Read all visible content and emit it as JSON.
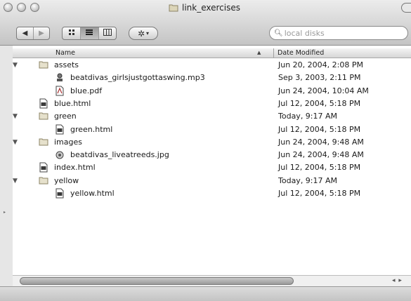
{
  "window": {
    "title": "link_exercises"
  },
  "toolbar": {
    "back_icon": "back-arrow-icon",
    "forward_icon": "forward-arrow-icon",
    "view_icons": [
      "icon-view-icon",
      "list-view-icon",
      "column-view-icon"
    ],
    "action_icon": "gear-icon"
  },
  "search": {
    "placeholder": "local disks"
  },
  "columns": {
    "name": "Name",
    "date": "Date Modified"
  },
  "rows": [
    {
      "name": "assets",
      "date": "Jun 20, 2004, 2:08 PM",
      "icon": "folder-icon",
      "level": 0,
      "expanded": true
    },
    {
      "name": "beatdivas_girlsjustgottaswing.mp3",
      "date": "Sep 3, 2003, 2:11 PM",
      "icon": "audio-file-icon",
      "level": 1
    },
    {
      "name": "blue.pdf",
      "date": "Jun 24, 2004, 10:04 AM",
      "icon": "pdf-file-icon",
      "level": 1
    },
    {
      "name": "blue.html",
      "date": "Jul 12, 2004, 5:18 PM",
      "icon": "html-file-icon",
      "level": 0
    },
    {
      "name": "green",
      "date": "Today, 9:17 AM",
      "icon": "folder-icon",
      "level": 0,
      "expanded": true
    },
    {
      "name": "green.html",
      "date": "Jul 12, 2004, 5:18 PM",
      "icon": "html-file-icon",
      "level": 1
    },
    {
      "name": "images",
      "date": "Jun 24, 2004, 9:48 AM",
      "icon": "folder-icon",
      "level": 0,
      "expanded": true
    },
    {
      "name": "beatdivas_liveatreeds.jpg",
      "date": "Jun 24, 2004, 9:48 AM",
      "icon": "image-file-icon",
      "level": 1
    },
    {
      "name": "index.html",
      "date": "Jul 12, 2004, 5:18 PM",
      "icon": "html-file-icon",
      "level": 0
    },
    {
      "name": "yellow",
      "date": "Today, 9:17 AM",
      "icon": "folder-icon",
      "level": 0,
      "expanded": true
    },
    {
      "name": "yellow.html",
      "date": "Jul 12, 2004, 5:18 PM",
      "icon": "html-file-icon",
      "level": 1
    }
  ]
}
